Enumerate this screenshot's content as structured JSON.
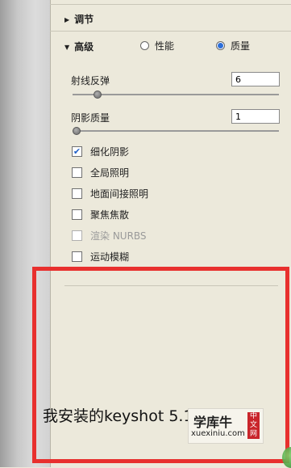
{
  "panel": {
    "adjust_section": "调节",
    "advanced_section": "高级",
    "mode_options": [
      {
        "label": "性能",
        "selected": false
      },
      {
        "label": "质量",
        "selected": true
      }
    ],
    "ray_bounces": {
      "label": "射线反弹",
      "value": "6",
      "slider_fraction": 0.12
    },
    "shadow_quality": {
      "label": "阴影质量",
      "value": "1",
      "slider_fraction": 0.02
    },
    "checkboxes": [
      {
        "label": "细化阴影",
        "checked": true,
        "enabled": true
      },
      {
        "label": "全局照明",
        "checked": false,
        "enabled": true
      },
      {
        "label": "地面间接照明",
        "checked": false,
        "enabled": true
      },
      {
        "label": "聚焦焦散",
        "checked": false,
        "enabled": true
      },
      {
        "label": "渲染 NURBS",
        "checked": false,
        "enabled": false
      },
      {
        "label": "运动模糊",
        "checked": false,
        "enabled": true
      }
    ]
  },
  "annotation": {
    "caption": "我安装的keyshot 5.1版本",
    "highlight_color": "#e8302e"
  },
  "watermark": {
    "title": "学库牛",
    "url": "xuexiniu.com",
    "seal": "中文网"
  }
}
